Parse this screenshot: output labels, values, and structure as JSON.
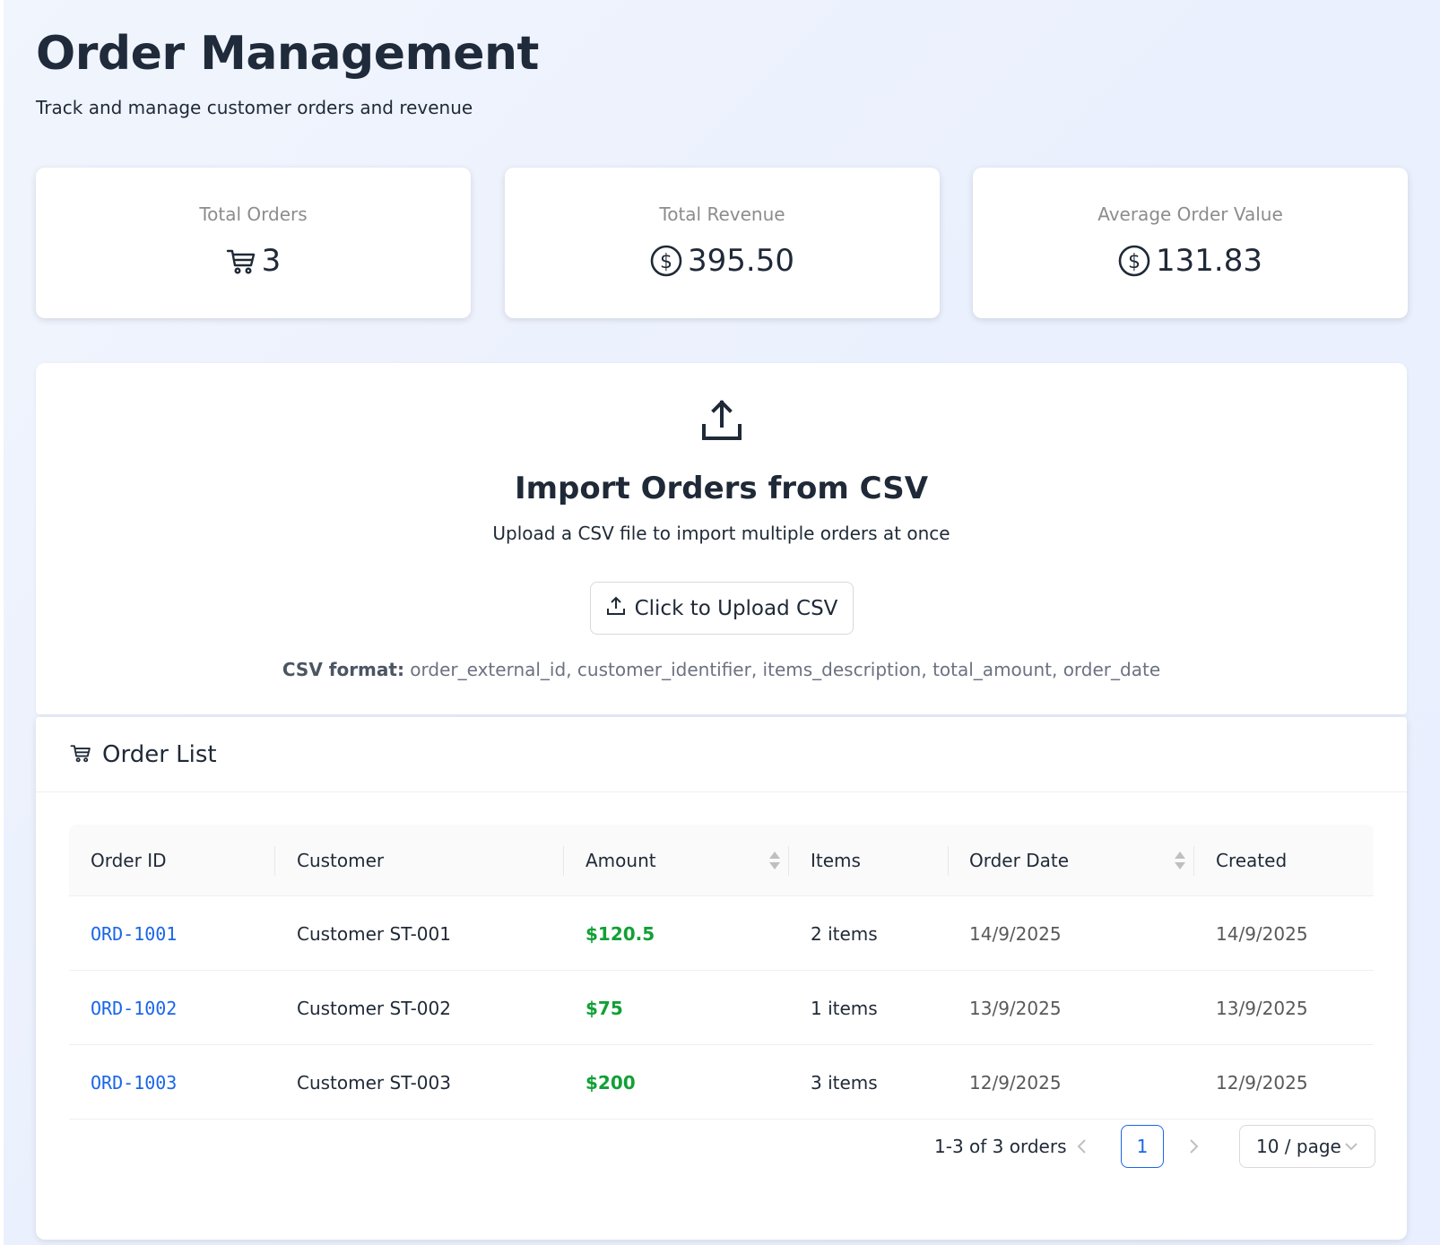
{
  "header": {
    "title": "Order Management",
    "subtitle": "Track and manage customer orders and revenue"
  },
  "stats": [
    {
      "title": "Total Orders",
      "value": "3",
      "icon": "shopping-cart-icon"
    },
    {
      "title": "Total Revenue",
      "value": "395.50",
      "icon": "dollar-circle-icon"
    },
    {
      "title": "Average Order Value",
      "value": "131.83",
      "icon": "dollar-circle-icon"
    }
  ],
  "upload": {
    "title": "Import Orders from CSV",
    "description": "Upload a CSV file to import multiple orders at once",
    "button_label": "Click to Upload CSV",
    "format_label": "CSV format:",
    "format_value": " order_external_id, customer_identifier, items_description, total_amount, order_date"
  },
  "orders": {
    "title": "Order List",
    "columns": [
      "Order ID",
      "Customer",
      "Amount",
      "Items",
      "Order Date",
      "Created"
    ],
    "rows": [
      {
        "id": "ORD-1001",
        "customer": "Customer ST-001",
        "amount": "$120.5",
        "items": "2 items",
        "order_date": "14/9/2025",
        "created": "14/9/2025"
      },
      {
        "id": "ORD-1002",
        "customer": "Customer ST-002",
        "amount": "$75",
        "items": "1 items",
        "order_date": "13/9/2025",
        "created": "13/9/2025"
      },
      {
        "id": "ORD-1003",
        "customer": "Customer ST-003",
        "amount": "$200",
        "items": "3 items",
        "order_date": "12/9/2025",
        "created": "12/9/2025"
      }
    ]
  },
  "pagination": {
    "total_text": "1-3 of 3 orders",
    "current_page": "1",
    "page_size": "10 / page"
  },
  "colors": {
    "accent": "#1a66e8",
    "amount": "#12a037"
  }
}
